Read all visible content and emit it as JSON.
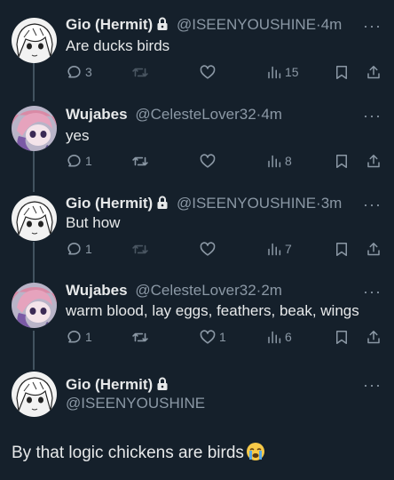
{
  "tweets": [
    {
      "name": "Gio (Hermit)",
      "handle": "@ISEENYOUSHINE",
      "time": "4m",
      "text": "Are ducks birds",
      "replies": "3",
      "retweets": "",
      "likes": "",
      "views": "15",
      "retweet_enabled": false
    },
    {
      "name": "Wujabes",
      "handle": "@CelesteLover32",
      "time": "4m",
      "text": "yes",
      "replies": "1",
      "retweets": "",
      "likes": "",
      "views": "8",
      "retweet_enabled": true
    },
    {
      "name": "Gio (Hermit)",
      "handle": "@ISEENYOUSHINE",
      "time": "3m",
      "text": "But how",
      "replies": "1",
      "retweets": "",
      "likes": "",
      "views": "7",
      "retweet_enabled": false
    },
    {
      "name": "Wujabes",
      "handle": "@CelesteLover32",
      "time": "2m",
      "text": "warm blood, lay eggs, feathers, beak, wings",
      "replies": "1",
      "retweets": "",
      "likes": "1",
      "views": "6",
      "retweet_enabled": true
    }
  ],
  "final_tweet": {
    "name": "Gio (Hermit)",
    "handle": "@ISEENYOUSHINE",
    "text": "By that logic chickens are birds"
  },
  "separator": "·",
  "more_glyph": "···",
  "icons": [
    "reply-icon",
    "retweet-icon",
    "like-icon",
    "views-icon",
    "bookmark-icon",
    "share-icon",
    "lock-icon",
    "more-icon",
    "crying-emoji-icon"
  ],
  "colors": {
    "background": "#15202b",
    "text": "#e7e9ea",
    "secondary": "#8b98a5",
    "thread_line": "#42535f"
  }
}
